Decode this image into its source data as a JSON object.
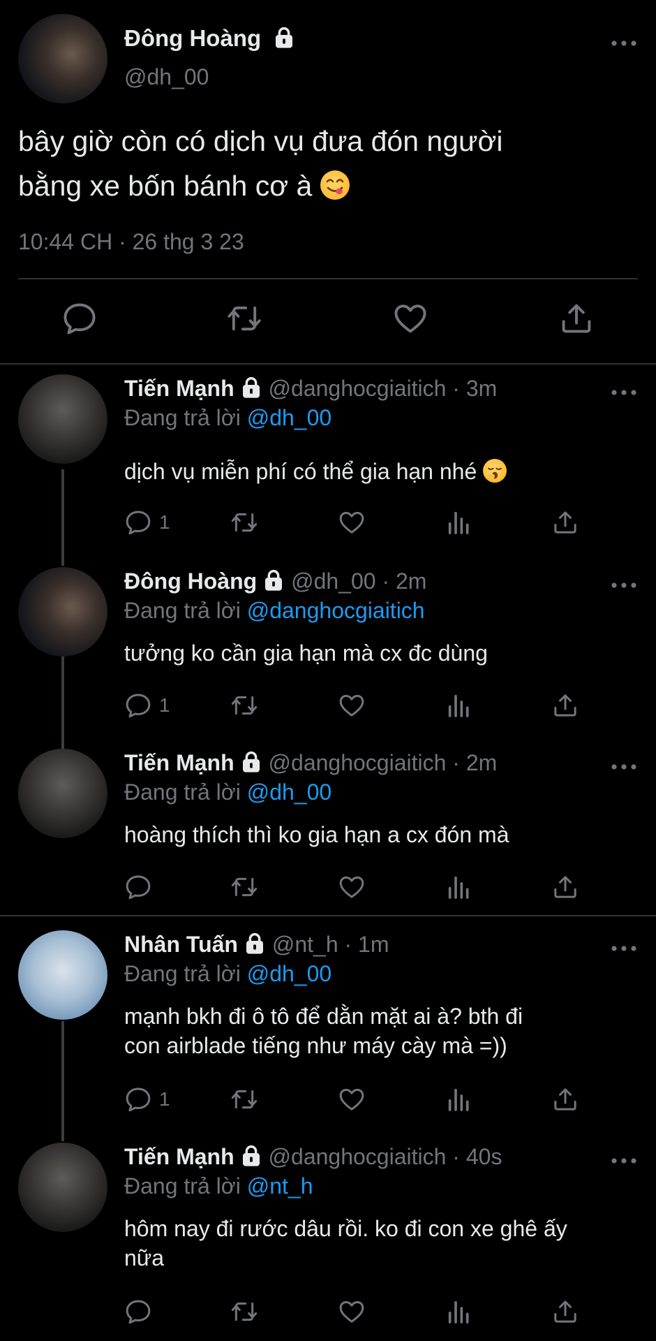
{
  "main_tweet": {
    "name": "Đông Hoàng",
    "handle": "@dh_00",
    "text_line1": "bây giờ còn có dịch vụ đưa đón người",
    "text_line2": "bằng xe bốn bánh cơ à",
    "timestamp": "10:44 CH · 26 thg 3 23",
    "icons": [
      "reply-icon",
      "retweet-icon",
      "like-icon",
      "share-icon"
    ]
  },
  "replies": [
    {
      "name": "Tiến Mạnh",
      "handle": "@danghocgiaitich",
      "time": "· 3m",
      "replying_prefix": "Đang trả lời",
      "replying_to": "@dh_00",
      "text": "dịch vụ miễn phí có thể gia hạn nhé",
      "reply_count": "1"
    },
    {
      "name": "Đông Hoàng",
      "handle": "@dh_00",
      "time": "· 2m",
      "replying_prefix": "Đang trả lời",
      "replying_to": "@danghocgiaitich",
      "text": "tưởng ko cần gia hạn mà cx đc dùng",
      "reply_count": "1"
    },
    {
      "name": "Tiến Mạnh",
      "handle": "@danghocgiaitich",
      "time": "· 2m",
      "replying_prefix": "Đang trả lời",
      "replying_to": "@dh_00",
      "text": "hoàng thích thì ko gia hạn a cx đón mà",
      "reply_count": ""
    },
    {
      "name": "Nhân Tuấn",
      "handle": "@nt_h",
      "time": "· 1m",
      "replying_prefix": "Đang trả lời",
      "replying_to": "@dh_00",
      "text_line1": "mạnh bkh đi ô tô để dằn mặt ai à? bth đi",
      "text_line2": "con airblade tiếng như máy cày mà =))",
      "reply_count": "1"
    },
    {
      "name": "Tiến Mạnh",
      "handle": "@danghocgiaitich",
      "time": "· 40s",
      "replying_prefix": "Đang trả lời",
      "replying_to": "@nt_h",
      "text_line1": "hôm nay đi rước dâu rồi. ko đi con xe ghê ấy",
      "text_line2": "nữa",
      "reply_count": ""
    }
  ],
  "colors": {
    "background": "#000000",
    "text": "#e7e9ea",
    "muted": "#71767b",
    "link": "#1d9bf0",
    "divider": "#2f3336"
  }
}
